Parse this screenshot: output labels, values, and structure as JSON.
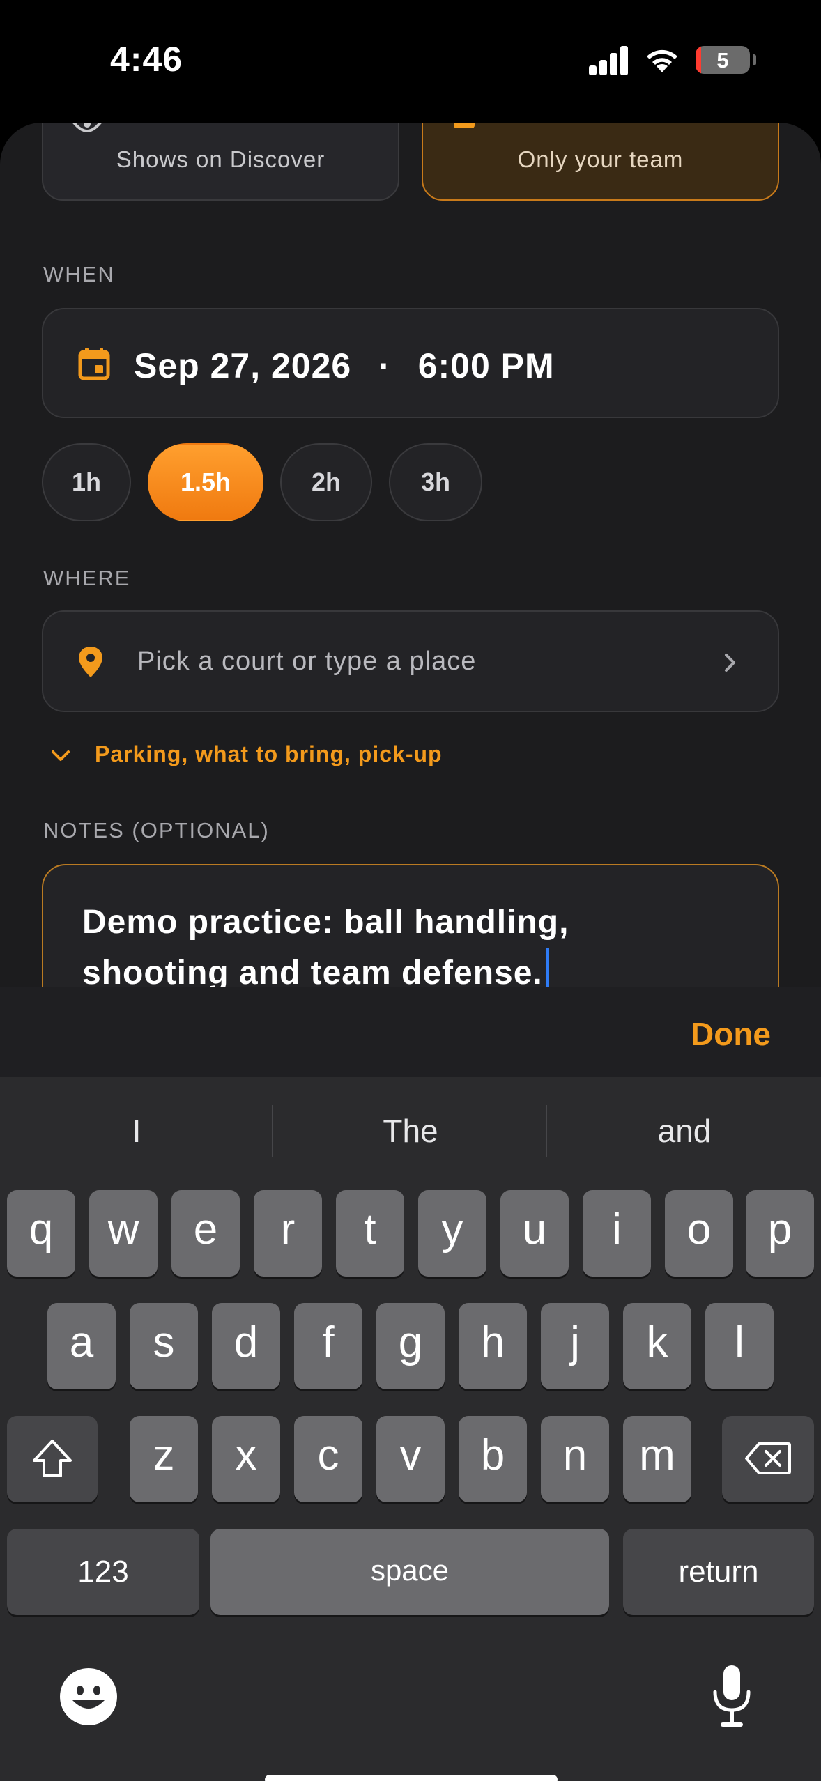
{
  "status_bar": {
    "time": "4:46",
    "battery_level": "5",
    "icons": [
      "signal-icon",
      "wifi-icon",
      "battery-icon"
    ]
  },
  "visibility": {
    "public_sub": "Shows on Discover",
    "team_sub": "Only your team",
    "selected": "team"
  },
  "when": {
    "label": "WHEN",
    "date": "Sep 27, 2026",
    "separator": "·",
    "time": "6:00 PM",
    "durations": [
      "1h",
      "1.5h",
      "2h",
      "3h"
    ],
    "selected_duration": "1.5h"
  },
  "where": {
    "label": "WHERE",
    "placeholder": "Pick a court or type a place",
    "extras_label": "Parking, what to bring, pick-up"
  },
  "notes": {
    "label": "NOTES (OPTIONAL)",
    "value_line1": "Demo practice: ball handling,",
    "value_line2": "shooting and team defense."
  },
  "accessory": {
    "done_label": "Done"
  },
  "keyboard": {
    "suggestions": [
      "I",
      "The",
      "and"
    ],
    "row1": [
      "q",
      "w",
      "e",
      "r",
      "t",
      "y",
      "u",
      "i",
      "o",
      "p"
    ],
    "row2": [
      "a",
      "s",
      "d",
      "f",
      "g",
      "h",
      "j",
      "k",
      "l"
    ],
    "row3": [
      "z",
      "x",
      "c",
      "v",
      "b",
      "n",
      "m"
    ],
    "numbers_label": "123",
    "space_label": "space",
    "return_label": "return"
  },
  "colors": {
    "accent": "#f39a1c",
    "background": "#1c1c1e",
    "caret": "#2f7cf6"
  }
}
